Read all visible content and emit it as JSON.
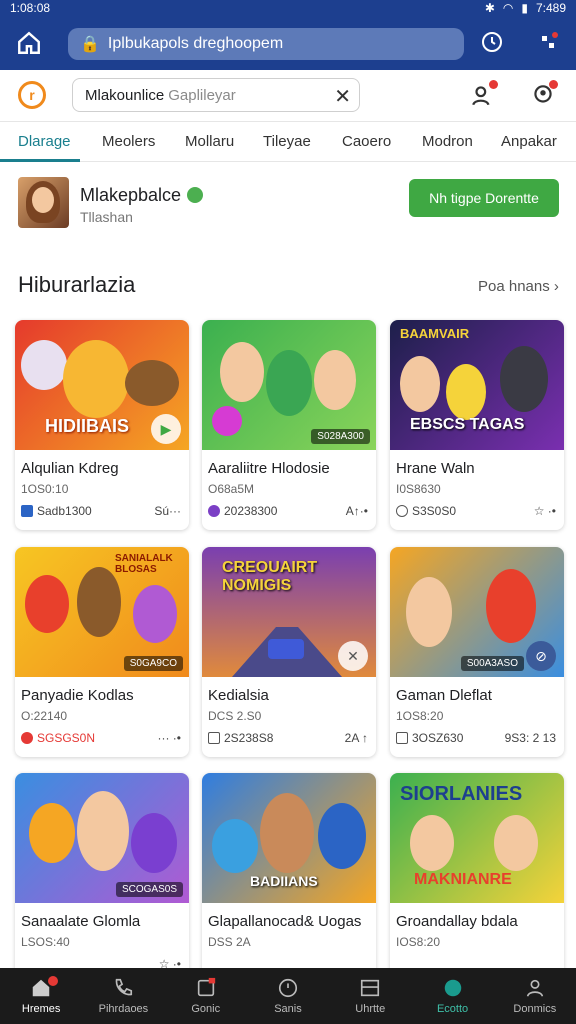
{
  "status_bar": {
    "time": "1:08:08",
    "battery": "7:489"
  },
  "browser": {
    "url": "Iplbukapols dreghoopem"
  },
  "app_bar": {
    "search_value": "Mlakounlice",
    "search_placeholder": "Gaplileyar"
  },
  "tabs": [
    "Dlarage",
    "Meolers",
    "Mollaru",
    "Tileyae",
    "Caoero",
    "Modron",
    "Anpakar"
  ],
  "profile": {
    "name": "Mlakepbalce",
    "subtitle": "Tllashan",
    "follow_label": "Nh tigpe Dorentte"
  },
  "section": {
    "title": "Hiburarlazia",
    "see_all": "Poa hnans"
  },
  "cards": [
    {
      "title": "Alqulian Kdreg",
      "sub": "1OS0:10",
      "meta": "Sadb1300",
      "meta_r": "Sú···",
      "thumb_text": "HIDIIBAIS",
      "tag": ""
    },
    {
      "title": "Aaraliitre Hlodosie",
      "sub": "O68a5M",
      "meta": "20238300",
      "meta_r": "A↑·•",
      "thumb_text": "",
      "tag": "S028A300"
    },
    {
      "title": "Hrane Waln",
      "sub": "I0S8630",
      "meta": "S3S0S0",
      "meta_r": "☆ ·•",
      "thumb_text": "EBSCS TAGAS",
      "tag": ""
    },
    {
      "title": "Panyadie Kodlas",
      "sub": "O:22140",
      "meta": "SGSGS0N",
      "meta_r": "··· ·•",
      "thumb_text": "SANIALALK BLOSAS",
      "tag": "S0GA9CO"
    },
    {
      "title": "Kedialsia",
      "sub": "DCS 2.S0",
      "meta": "2S238S8",
      "meta_r": "2A  ↑",
      "thumb_text": "CREOUAIRT NOMIGIS",
      "tag": ""
    },
    {
      "title": "Gaman Dleflat",
      "sub": "1OS8:20",
      "meta": "3OSZ630",
      "meta_r": "9S3: 2 13",
      "thumb_text": "",
      "tag": "S00A3ASO"
    },
    {
      "title": "Sanaalate Glomla",
      "sub": "LSOS:40",
      "meta": "",
      "meta_r": "☆ ·•",
      "thumb_text": "",
      "tag": "SCOGAS0S"
    },
    {
      "title": "Glapallanocad& Uogas",
      "sub": "DSS 2A",
      "meta": "",
      "meta_r": "",
      "thumb_text": "BADIIANS",
      "tag": ""
    },
    {
      "title": "Groandallay bdala",
      "sub": "IOS8:20",
      "meta": "",
      "meta_r": "",
      "thumb_text": "SIORLANIES",
      "thumb_text2": "MAKNIANRE",
      "tag": ""
    }
  ],
  "bottom_nav": [
    "Hremes",
    "Pihrdaoes",
    "Gonic",
    "Sanis",
    "Uhrtte",
    "Ecotto",
    "Donmics"
  ],
  "colors": {
    "primary": "#1d3f8f",
    "accent": "#1a7f8e",
    "follow": "#3fa843",
    "badge": "#e53935"
  }
}
